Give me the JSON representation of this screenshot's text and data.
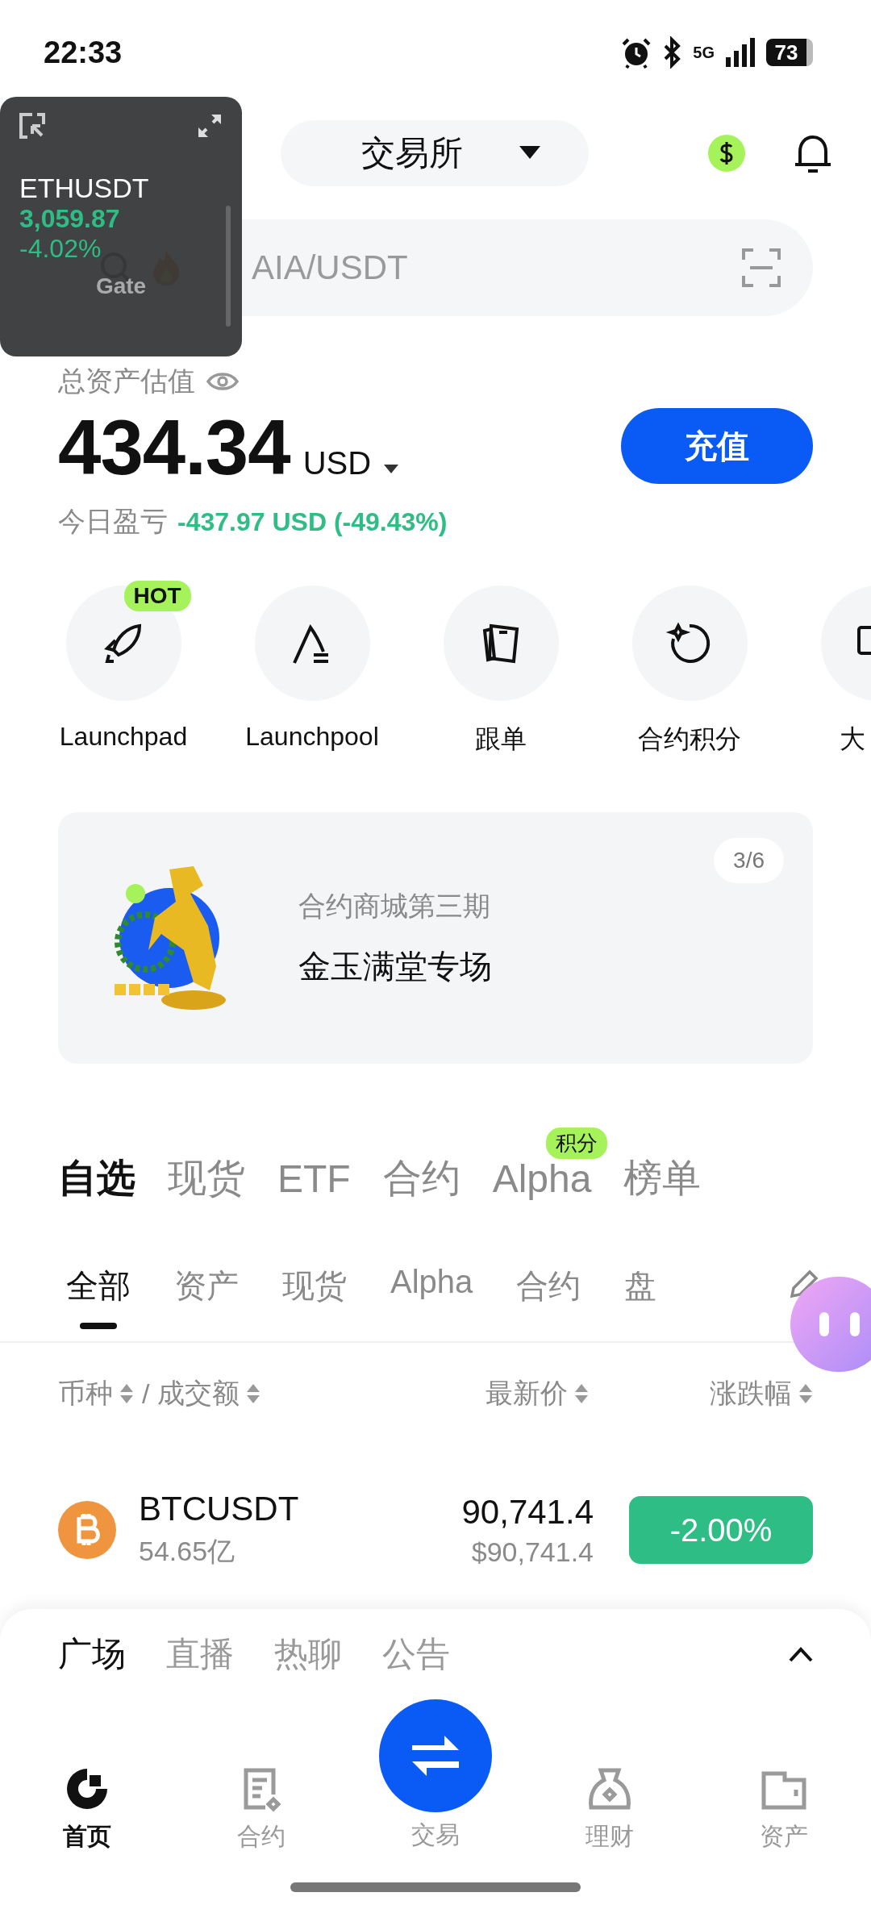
{
  "status_bar": {
    "time": "22:33",
    "network": "5G",
    "battery": "73"
  },
  "float_widget": {
    "symbol": "ETHUSDT",
    "price": "3,059.87",
    "change": "-4.02%",
    "brand": "Gate"
  },
  "header": {
    "mode_selector": "交易所"
  },
  "search": {
    "placeholder": "AIA/USDT"
  },
  "assets": {
    "label": "总资产估值",
    "value": "434.34",
    "currency": "USD",
    "deposit_button": "充值",
    "pnl_label": "今日盈亏",
    "pnl_value": "-437.97 USD (-49.43%)"
  },
  "shortcuts": [
    {
      "label": "Launchpad",
      "badge": "HOT"
    },
    {
      "label": "Launchpool"
    },
    {
      "label": "跟单"
    },
    {
      "label": "合约积分"
    },
    {
      "label": "大"
    }
  ],
  "banner": {
    "subtitle": "合约商城第三期",
    "title": "金玉满堂专场",
    "pager": "3/6"
  },
  "market_tabs": [
    {
      "label": "自选",
      "selected": true
    },
    {
      "label": "现货",
      "selected": false
    },
    {
      "label": "ETF",
      "selected": false
    },
    {
      "label": "合约",
      "selected": false
    },
    {
      "label": "Alpha",
      "selected": false,
      "badge": "积分"
    },
    {
      "label": "榜单",
      "selected": false
    }
  ],
  "sub_tabs": [
    {
      "label": "全部",
      "selected": true
    },
    {
      "label": "资产",
      "selected": false
    },
    {
      "label": "现货",
      "selected": false
    },
    {
      "label": "Alpha",
      "selected": false
    },
    {
      "label": "合约",
      "selected": false
    },
    {
      "label": "盘",
      "selected": false
    }
  ],
  "columns": {
    "pair": "币种",
    "separator": "/",
    "volume": "成交额",
    "price": "最新价",
    "change": "涨跌幅"
  },
  "rows": [
    {
      "symbol": "BTCUSDT",
      "volume": "54.65亿",
      "price": "90,741.4",
      "price_usd": "$90,741.4",
      "change": "-2.00%"
    }
  ],
  "feed_tabs": [
    {
      "label": "广场",
      "selected": true
    },
    {
      "label": "直播",
      "selected": false
    },
    {
      "label": "热聊",
      "selected": false
    },
    {
      "label": "公告",
      "selected": false
    }
  ],
  "nav": [
    {
      "label": "首页",
      "selected": true,
      "kind": "tab"
    },
    {
      "label": "合约",
      "selected": false,
      "kind": "tab"
    },
    {
      "label": "交易",
      "selected": false,
      "kind": "center"
    },
    {
      "label": "理财",
      "selected": false,
      "kind": "tab"
    },
    {
      "label": "资产",
      "selected": false,
      "kind": "tab"
    }
  ]
}
